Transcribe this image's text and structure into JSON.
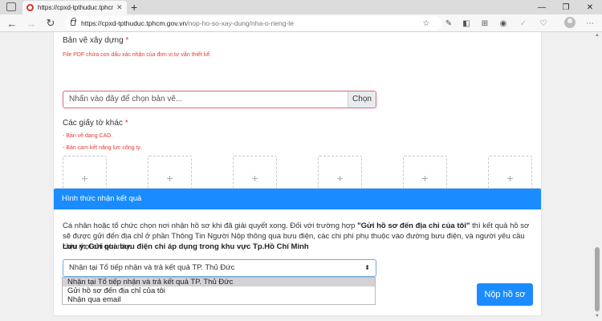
{
  "browser": {
    "tab_title": "https://cpxd-tpthuduc.tphcm.gov",
    "new_tab_symbol": "+",
    "url_host": "https://cpxd-tpthuduc.tphcm.gov.vn",
    "url_path": "/nop-ho-so-xay-dung/nha-o-rieng-le",
    "icons": [
      "tab-actions-icon",
      "back-icon",
      "forward-icon",
      "refresh-icon",
      "home-icon",
      "star-icon",
      "extension-icon",
      "profile-icon",
      "menu-icon"
    ]
  },
  "form": {
    "drawing_label": "Bản vẽ xây dựng",
    "required_mark": "*",
    "drawing_note": "File PDF chứa con dấu xác nhận của đơn vị tư vấn thiết kế.",
    "file_placeholder": "Nhấn vào đây để chọn bản vẽ...",
    "choose_button": "Chọn",
    "other_docs_label": "Các giấy tờ khác",
    "other_notes": [
      "- Bản vẽ dạng CAD.",
      "- Bản cam kết năng lực công ty."
    ],
    "upload_symbol": "+",
    "upload_box_count": 6
  },
  "result": {
    "header": "Hình thức nhận kết quả",
    "paragraph_1": "Cá nhân hoặc tổ chức chọn nơi nhận hồ sơ khi đã giải quyết xong. Đối với trường hợp ",
    "paragraph_bold": "\"Gửi hồ sơ đến địa chỉ của tôi\"",
    "paragraph_2": " thì kết quả hồ sơ sẽ được gửi đến địa chỉ ở phần Thông Tin Người Nộp thông qua bưu điện, các chi phí phụ thuộc vào đường bưu điện, và người yêu cầu chịu mọi chi phí này.",
    "note": "Lưu ý: Gửi qua bưu điện chỉ áp dụng trong khu vực Tp.Hồ Chí Minh",
    "selected_option": "Nhận tại Tổ tiếp nhận và trả kết quả TP. Thủ Đức",
    "options": [
      "Nhận tại Tổ tiếp nhận và trả kết quả TP. Thủ Đức",
      "Gửi hồ sơ đến địa chỉ của tôi",
      "Nhận qua email"
    ],
    "submit_label": "Nộp hồ sơ"
  },
  "colors": {
    "accent": "#1a8cff",
    "required": "#e53935"
  }
}
